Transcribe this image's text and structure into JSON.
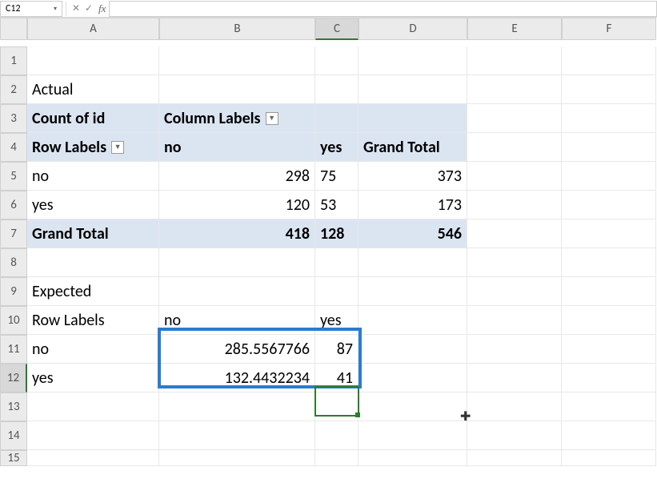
{
  "toolbar": {
    "name_box": "C12",
    "formula_value": ""
  },
  "columns": [
    "",
    "A",
    "B",
    "C",
    "D",
    "E",
    "F"
  ],
  "rows": [
    "1",
    "2",
    "3",
    "4",
    "5",
    "6",
    "7",
    "8",
    "9",
    "10",
    "11",
    "12",
    "13",
    "14",
    "15"
  ],
  "cells": {
    "A2": "Actual",
    "A3": "Count of id",
    "B3": "Column Labels",
    "A4": "Row Labels",
    "B4": "no",
    "C4": "yes",
    "D4": "Grand Total",
    "A5": "no",
    "B5": "298",
    "C5": "75",
    "D5": "373",
    "A6": "yes",
    "B6": "120",
    "C6": "53",
    "D6": "173",
    "A7": "Grand Total",
    "B7": "418",
    "C7": "128",
    "D7": "546",
    "A9": "Expected",
    "A10": "Row Labels",
    "B10": "no",
    "C10": "yes",
    "A11": "no",
    "B11": "285.5567766",
    "C11": "87",
    "A12": "yes",
    "B12": "132.4432234",
    "C12": "41"
  },
  "icons": {
    "dropdown": "▾",
    "cancel": "✕",
    "accept": "✓",
    "fx": "fx",
    "filter": "▼"
  }
}
